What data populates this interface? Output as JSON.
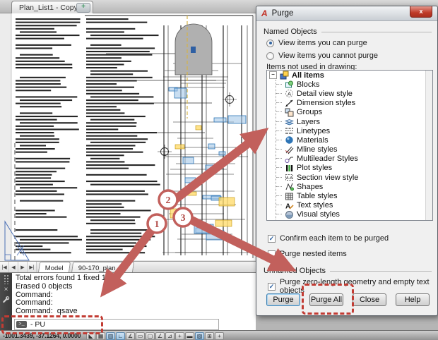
{
  "window": {
    "document_tab": {
      "label": "Plan_List1 - Copy",
      "close_icon": "×",
      "new_tab_icon": "+"
    }
  },
  "drawing_area": {
    "layout_bar": {
      "nav_icons": [
        "|◀",
        "◀",
        "▶",
        "▶|"
      ],
      "tabs": [
        {
          "label": "Model",
          "active": true
        },
        {
          "label": "90-170_plan_50",
          "active": false
        }
      ]
    }
  },
  "command_panel": {
    "history_lines": [
      "Total errors found 1 fixed 1",
      "Erased 0 objects",
      "Command:",
      "Command:",
      "Command:  qsave"
    ],
    "prompt_icon": ">_",
    "input_value": "- PU",
    "close_icon": "×"
  },
  "status_bar": {
    "coordinates": "-1001.3439, -37.1264, 0.0000",
    "toggles": [
      {
        "name": "infer-constraints",
        "glyph": "◣",
        "active": false
      },
      {
        "name": "snap-mode",
        "glyph": "▦",
        "active": false
      },
      {
        "name": "grid-display",
        "glyph": "▥",
        "active": true
      },
      {
        "name": "ortho-mode",
        "glyph": "∟",
        "active": true
      },
      {
        "name": "polar-tracking",
        "glyph": "∡",
        "active": false
      },
      {
        "name": "object-snap",
        "glyph": "▭",
        "active": false
      },
      {
        "name": "3d-object-snap",
        "glyph": "▢",
        "active": false
      },
      {
        "name": "object-snap-tracking",
        "glyph": "∠",
        "active": false
      },
      {
        "name": "dynamic-ucs",
        "glyph": "⊿",
        "active": false
      },
      {
        "name": "dynamic-input",
        "glyph": "+",
        "active": false
      },
      {
        "name": "show-hide-lineweight",
        "glyph": "▬",
        "active": false
      },
      {
        "name": "show-hide-transparency",
        "glyph": "▨",
        "active": true
      },
      {
        "name": "quick-properties",
        "glyph": "⊞",
        "active": false
      },
      {
        "name": "selection-cycling",
        "glyph": "+",
        "active": false
      }
    ]
  },
  "purge_dialog": {
    "title": "Purge",
    "close_icon": "x",
    "groups": {
      "named": "Named Objects",
      "unnamed": "Unnamed Objects"
    },
    "radios": [
      {
        "label": "View items you can purge",
        "selected": true
      },
      {
        "label": "View items you cannot purge",
        "selected": false
      }
    ],
    "tree_label": "Items not used in drawing:",
    "tree": {
      "root": {
        "label": "All items",
        "icon": "all-items-icon",
        "expanded": true
      },
      "items": [
        {
          "label": "Blocks",
          "icon": "blocks-icon"
        },
        {
          "label": "Detail view style",
          "icon": "detail-view-style-icon"
        },
        {
          "label": "Dimension styles",
          "icon": "dimension-styles-icon"
        },
        {
          "label": "Groups",
          "icon": "groups-icon"
        },
        {
          "label": "Layers",
          "icon": "layers-icon"
        },
        {
          "label": "Linetypes",
          "icon": "linetypes-icon"
        },
        {
          "label": "Materials",
          "icon": "materials-icon"
        },
        {
          "label": "Mline styles",
          "icon": "mline-styles-icon"
        },
        {
          "label": "Multileader Styles",
          "icon": "multileader-styles-icon"
        },
        {
          "label": "Plot styles",
          "icon": "plot-styles-icon"
        },
        {
          "label": "Section view style",
          "icon": "section-view-style-icon"
        },
        {
          "label": "Shapes",
          "icon": "shapes-icon"
        },
        {
          "label": "Table styles",
          "icon": "table-styles-icon"
        },
        {
          "label": "Text styles",
          "icon": "text-styles-icon"
        },
        {
          "label": "Visual styles",
          "icon": "visual-styles-icon"
        }
      ]
    },
    "checkboxes": [
      {
        "label": "Confirm each item to be purged",
        "checked": true
      },
      {
        "label": "Purge nested items",
        "checked": false
      }
    ],
    "unnamed_checkbox": {
      "label": "Purge zero-length geometry and empty text objects",
      "checked": true
    },
    "buttons": [
      {
        "name": "purge-button",
        "label": "Purge",
        "focused": true,
        "highlighted": false
      },
      {
        "name": "purge-all-button",
        "label": "Purge All",
        "focused": false,
        "highlighted": true
      },
      {
        "name": "close-button",
        "label": "Close",
        "focused": false,
        "highlighted": false
      },
      {
        "name": "help-button",
        "label": "Help",
        "focused": false,
        "highlighted": false
      }
    ]
  },
  "annotations": {
    "step_badges": [
      "1",
      "2",
      "3"
    ],
    "arrow_color": "#c2605c",
    "badge_text_color": "#b14a46",
    "highlight_box_color": "#c23b33"
  }
}
